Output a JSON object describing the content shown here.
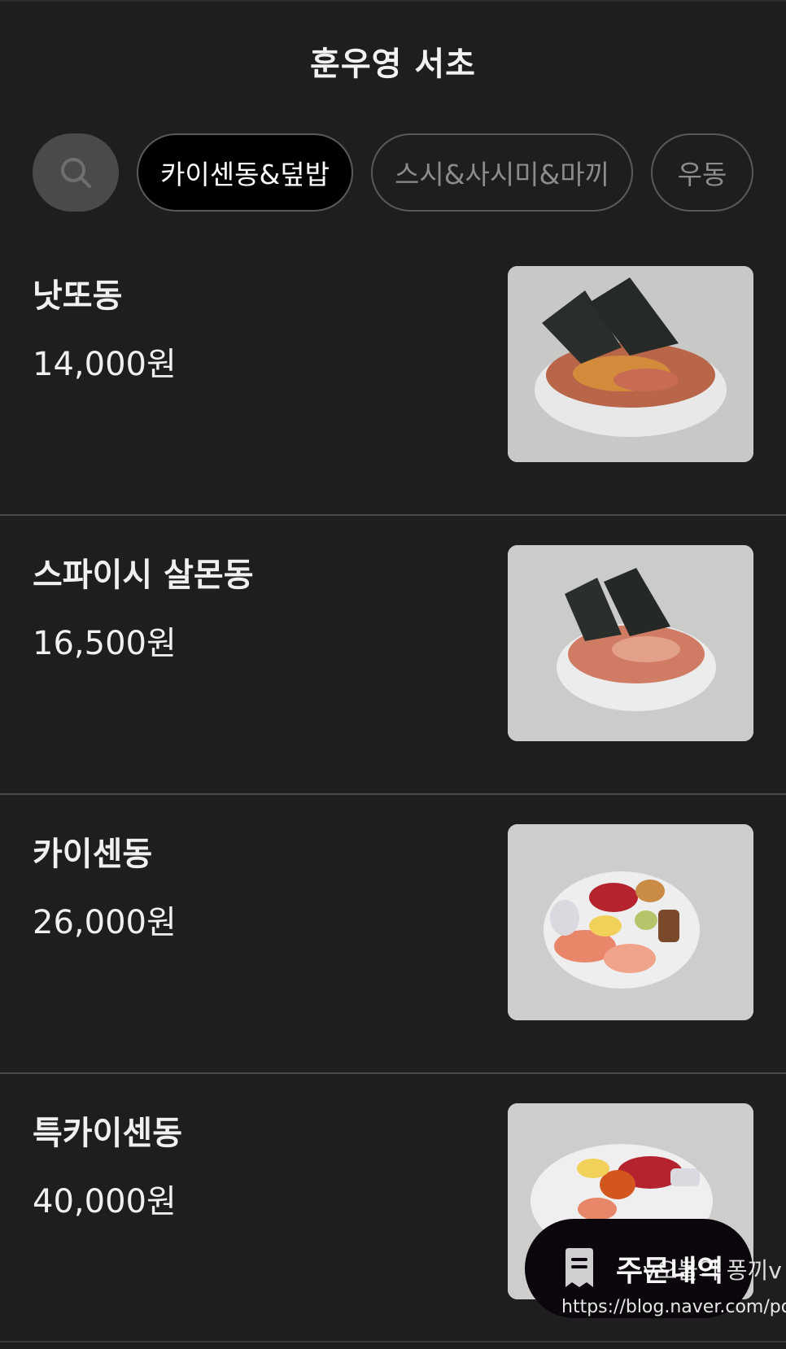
{
  "header": {
    "title": "훈우영 서초"
  },
  "categories": [
    {
      "label": "카이센동&덮밥",
      "active": true
    },
    {
      "label": "스시&사시미&마끼",
      "active": false
    },
    {
      "label": "우동",
      "active": false
    }
  ],
  "search": {
    "icon": "search-icon"
  },
  "menu": [
    {
      "name": "낫또동",
      "price": "14,000원"
    },
    {
      "name": "스파이시 살몬동",
      "price": "16,500원"
    },
    {
      "name": "카이센동",
      "price": "26,000원"
    },
    {
      "name": "특카이센동",
      "price": "40,000원"
    }
  ],
  "order_button": {
    "label": "주문내역",
    "icon": "receipt-icon"
  },
  "watermark": {
    "line1": "v오불의 퐁끼v",
    "line2": "https://blog.naver.com/pongkki"
  },
  "colors": {
    "background": "#1e1e1e",
    "chip_active_bg": "#000000",
    "chip_border": "#5a5a5a",
    "order_button_bg": "#0b060c"
  }
}
